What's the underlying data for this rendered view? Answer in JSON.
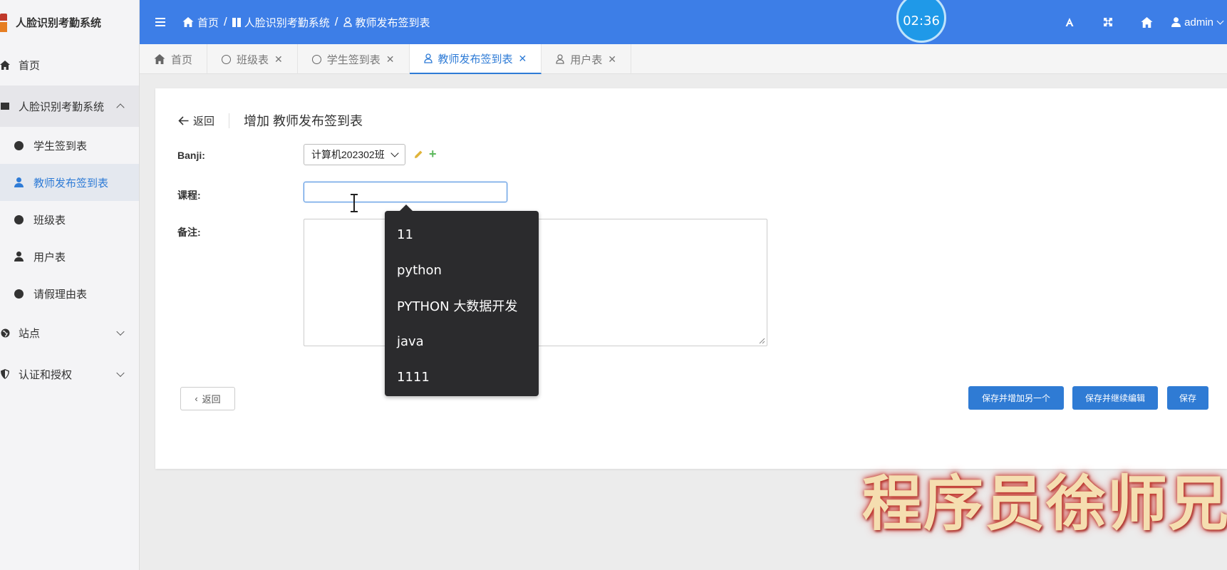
{
  "app": {
    "title": "人脸识别考勤系统"
  },
  "sidebar": {
    "home": "首页",
    "group_label": "人脸识别考勤系统",
    "sub_items": [
      {
        "label": "学生签到表",
        "icon": "circle-icon"
      },
      {
        "label": "教师发布签到表",
        "icon": "user-icon",
        "active": true
      },
      {
        "label": "班级表",
        "icon": "circle-icon"
      },
      {
        "label": "用户表",
        "icon": "user-icon"
      },
      {
        "label": "请假理由表",
        "icon": "circle-icon"
      }
    ],
    "site": "站点",
    "auth": "认证和授权"
  },
  "header": {
    "breadcrumb": [
      "首页",
      "人脸识别考勤系统",
      "教师发布签到表"
    ],
    "timer": "02:36",
    "user": "admin"
  },
  "tabs": [
    {
      "label": "首页",
      "icon": "home-icon"
    },
    {
      "label": "班级表",
      "icon": "circle-icon"
    },
    {
      "label": "学生签到表",
      "icon": "circle-icon"
    },
    {
      "label": "教师发布签到表",
      "icon": "user-icon",
      "active": true
    },
    {
      "label": "用户表",
      "icon": "user-icon"
    }
  ],
  "form": {
    "back": "返回",
    "title": "增加 教师发布签到表",
    "banji_label": "Banji:",
    "banji_value": "计算机202302班",
    "course_label": "课程:",
    "course_value": "",
    "remark_label": "备注:",
    "suggestions": [
      "11",
      "python",
      "PYTHON 大数据开发",
      "java",
      "1111"
    ],
    "bottom_back": "返回",
    "save_add": "保存并增加另一个",
    "save_continue": "保存并继续编辑",
    "save": "保存"
  },
  "watermark": "程序员徐师兄",
  "colors": {
    "header": "#3d7ee7",
    "accent": "#2e7bd6",
    "primary_button": "#2f7bd4",
    "dropdown": "#2b2b2d"
  }
}
